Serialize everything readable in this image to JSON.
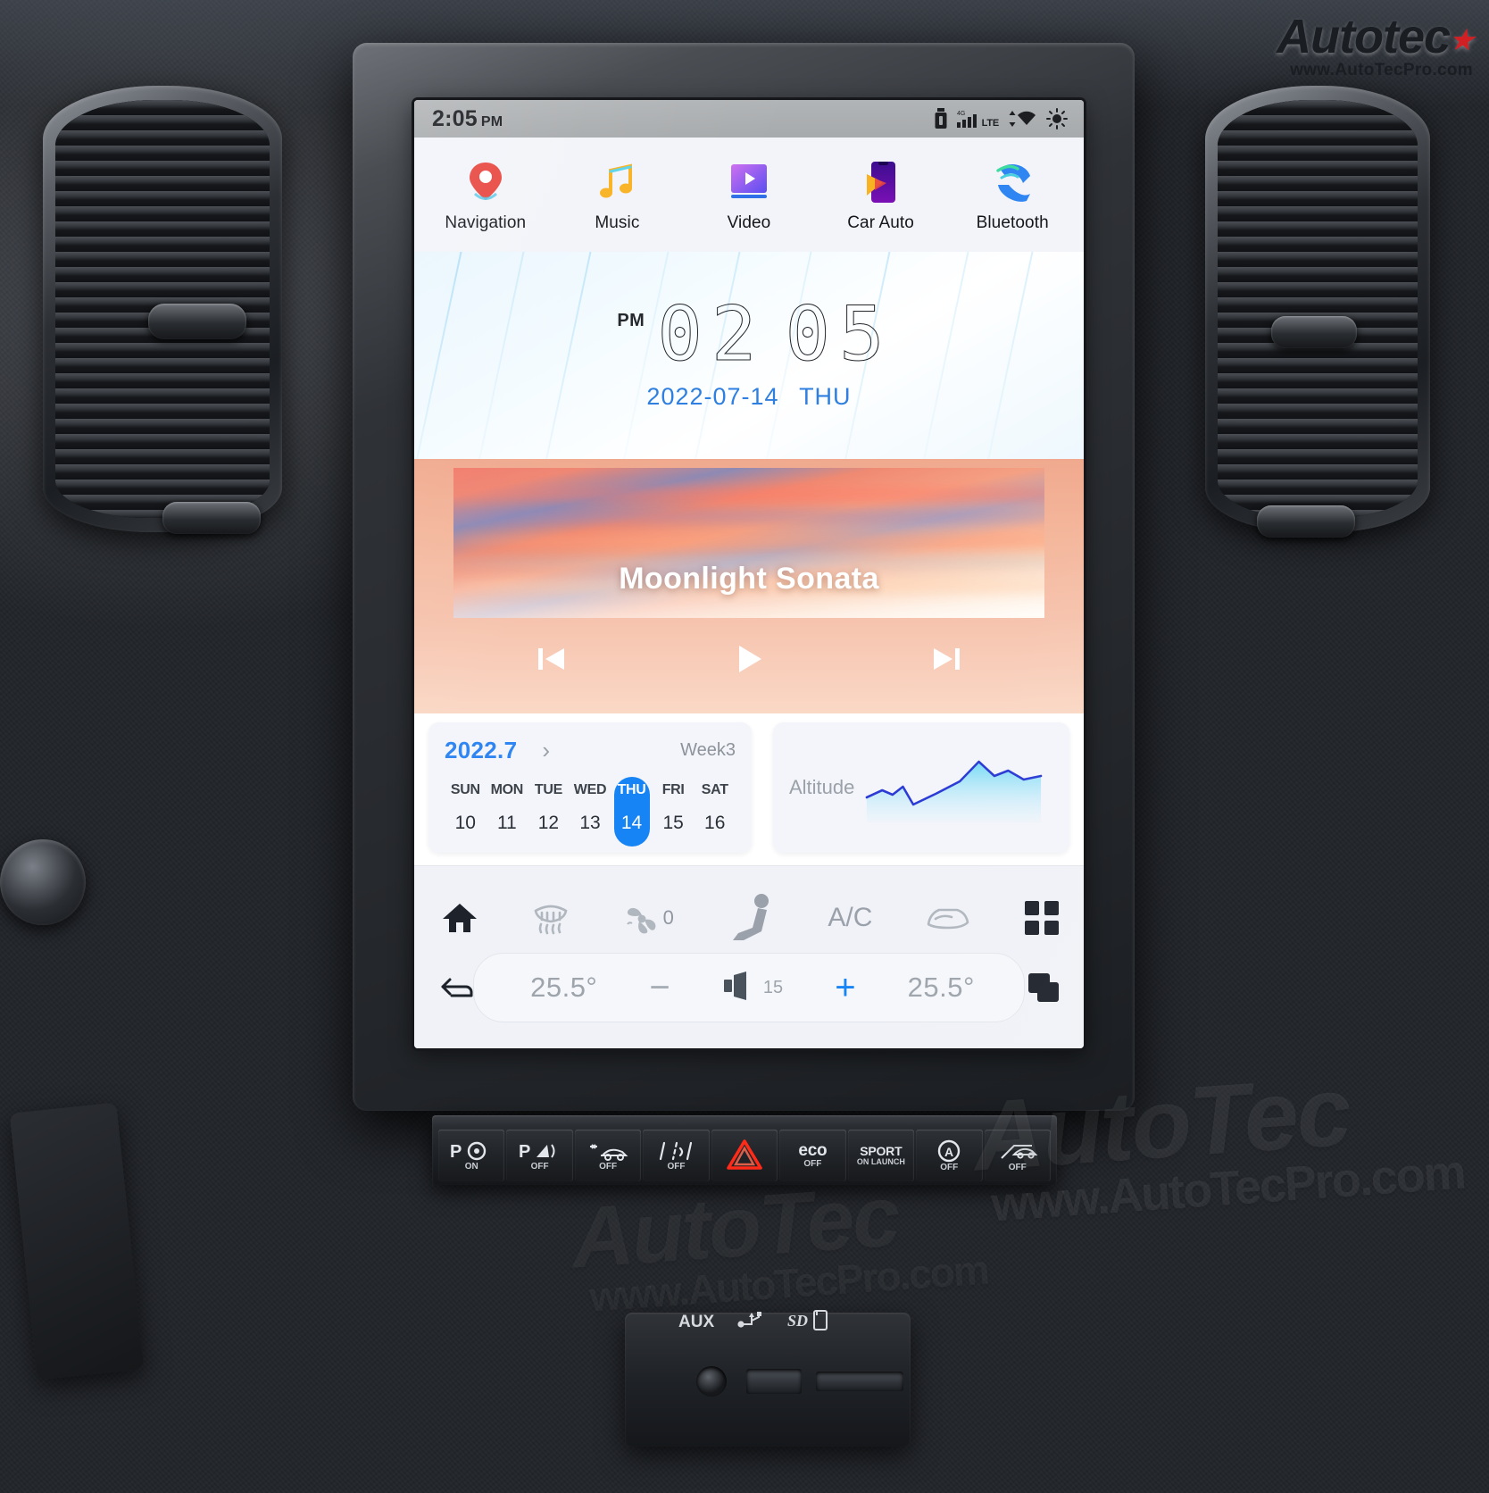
{
  "brand": {
    "name": "Autotec",
    "url": "www.AutoTecPro.com",
    "star_icon": "star-icon"
  },
  "watermarks": {
    "big": "AutoTec",
    "small": "www.AutoTecPro.com"
  },
  "screen": {
    "statusbar": {
      "time": "2:05",
      "ampm": "PM",
      "icons": [
        {
          "name": "usb-storage-icon"
        },
        {
          "name": "cellular-signal-icon",
          "label": "LTE",
          "network": "4G"
        },
        {
          "name": "wifi-icon"
        },
        {
          "name": "brightness-icon"
        }
      ]
    },
    "apps": [
      {
        "label": "Navigation",
        "icon": "map-pin-icon"
      },
      {
        "label": "Music",
        "icon": "music-note-icon"
      },
      {
        "label": "Video",
        "icon": "video-play-icon"
      },
      {
        "label": "Car Auto",
        "icon": "carplay-icon"
      },
      {
        "label": "Bluetooth",
        "icon": "phone-call-icon"
      }
    ],
    "clock_widget": {
      "ampm": "PM",
      "hours": "02",
      "minutes": "05",
      "date": "2022-07-14",
      "weekday": "THU"
    },
    "music_widget": {
      "track_title": "Moonlight Sonata",
      "prev_icon": "skip-previous-icon",
      "play_icon": "play-icon",
      "next_icon": "skip-next-icon"
    },
    "calendar_card": {
      "month": "2022.7",
      "chevron_icon": "chevron-right-icon",
      "week_label": "Week3",
      "days_of_week": [
        "SUN",
        "MON",
        "TUE",
        "WED",
        "THU",
        "FRI",
        "SAT"
      ],
      "dates": [
        "10",
        "11",
        "12",
        "13",
        "14",
        "15",
        "16"
      ],
      "selected_index": 4,
      "accent_color": "#1784f5"
    },
    "altitude_card": {
      "label": "Altitude",
      "line_color": "#2b3bd4",
      "fill_color": "#6fd9f5"
    },
    "climate_bar": [
      {
        "name": "home-icon",
        "label": ""
      },
      {
        "name": "rear-defrost-icon",
        "label": ""
      },
      {
        "name": "fan-icon",
        "label": "0"
      },
      {
        "name": "seat-heat-icon",
        "label": ""
      },
      {
        "name": "ac-icon",
        "label": "A/C"
      },
      {
        "name": "front-defrost-icon",
        "label": ""
      },
      {
        "name": "apps-grid-icon",
        "label": ""
      }
    ],
    "bottom_bar": {
      "back_icon": "back-arrow-icon",
      "temp_left": "25.5°",
      "minus_label": "−",
      "volume_icon": "volume-icon",
      "volume_value": "15",
      "plus_label": "+",
      "temp_right": "25.5°",
      "recent_icon": "recent-apps-icon"
    }
  },
  "physical_buttons": [
    {
      "name": "park-assist-button",
      "glyph": "P",
      "sub": "ON",
      "icon": "steering-wheel-icon"
    },
    {
      "name": "parking-sensor-button",
      "glyph": "P",
      "sub": "OFF",
      "icon": "parking-waves-icon"
    },
    {
      "name": "traction-control-button",
      "glyph": "",
      "sub": "OFF",
      "icon": "car-skid-icon"
    },
    {
      "name": "lane-assist-button",
      "glyph": "",
      "sub": "OFF",
      "icon": "lane-departure-icon"
    },
    {
      "name": "hazard-lights-button",
      "glyph": "▲",
      "sub": "",
      "icon": "hazard-triangle-icon"
    },
    {
      "name": "eco-mode-button",
      "glyph": "eco",
      "sub": "OFF",
      "icon": ""
    },
    {
      "name": "sport-mode-button",
      "glyph": "SPORT",
      "sub": "ON LAUNCH",
      "icon": ""
    },
    {
      "name": "auto-start-stop-button",
      "glyph": "Ⓐ",
      "sub": "OFF",
      "icon": "auto-stop-icon"
    },
    {
      "name": "hill-assist-button",
      "glyph": "",
      "sub": "OFF",
      "icon": "hill-descent-icon"
    }
  ],
  "console_ports": [
    {
      "label": "AUX",
      "icon": "aux-jack-icon"
    },
    {
      "label": "",
      "icon": "usb-icon"
    },
    {
      "label": "",
      "icon": "sd-card-icon"
    }
  ]
}
